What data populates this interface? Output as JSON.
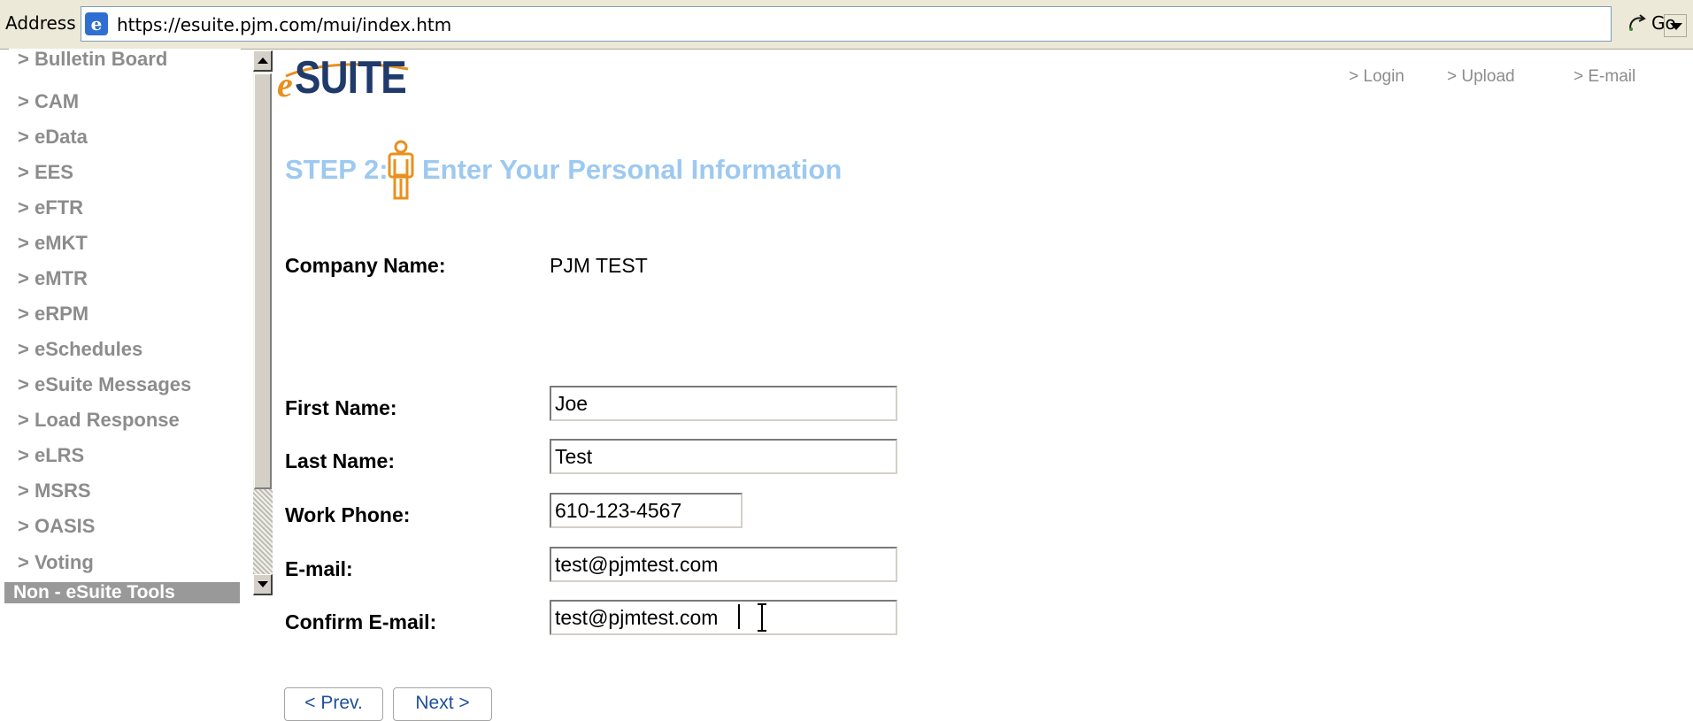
{
  "browser": {
    "address_label": "Address",
    "url": "https://esuite.pjm.com/mui/index.htm",
    "go_label": "Go"
  },
  "sidebar": {
    "items": [
      {
        "label": "> Bulletin Board"
      },
      {
        "label": "> CAM"
      },
      {
        "label": "> eData"
      },
      {
        "label": "> EES"
      },
      {
        "label": "> eFTR"
      },
      {
        "label": "> eMKT"
      },
      {
        "label": "> eMTR"
      },
      {
        "label": "> eRPM"
      },
      {
        "label": "> eSchedules"
      },
      {
        "label": "> eSuite Messages"
      },
      {
        "label": "> Load Response"
      },
      {
        "label": "> eLRS"
      },
      {
        "label": "> MSRS"
      },
      {
        "label": "> OASIS"
      },
      {
        "label": "> Voting"
      }
    ],
    "section_header": "Non - eSuite Tools"
  },
  "header": {
    "logo_e": "e",
    "logo_rest": "SUITE",
    "links": {
      "login": "> Login",
      "upload": "> Upload",
      "email": "> E-mail"
    }
  },
  "step": {
    "prefix": "STEP 2:",
    "title": "Enter Your Personal Information"
  },
  "form": {
    "company_label": "Company Name:",
    "company_value": "PJM TEST",
    "first_name_label": "First Name:",
    "first_name_value": "Joe",
    "last_name_label": "Last Name:",
    "last_name_value": "Test",
    "work_phone_label": "Work Phone:",
    "work_phone_value": "610-123-4567",
    "email_label": "E-mail:",
    "email_value": "test@pjmtest.com",
    "confirm_email_label": "Confirm E-mail:",
    "confirm_email_value": "test@pjmtest.com"
  },
  "buttons": {
    "prev": "< Prev.",
    "next": "Next >"
  },
  "colors": {
    "step_title": "#9dc9f0",
    "logo_orange": "#e8901e",
    "logo_navy": "#1f3a6b",
    "sidebar_text": "#8c8c8c",
    "button_text": "#1e4f9c"
  },
  "icons": {
    "browser_page": "ie-page-icon",
    "go": "go-arrow-icon",
    "step": "person-icon"
  }
}
